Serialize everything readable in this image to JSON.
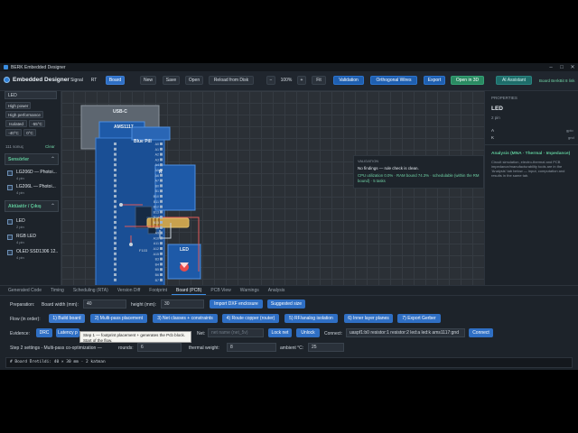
{
  "window": {
    "title": "BERK Embedded Designer"
  },
  "toolbar": {
    "brand": "Embedded Designer",
    "view_tabs": [
      "Signal",
      "RT",
      "Board"
    ],
    "new": "New",
    "save": "Save",
    "open": "Open",
    "reload": "Reload from Disk",
    "zoom_out": "−",
    "zoom": "100%",
    "zoom_in": "+",
    "fit": "Fit",
    "validation": "Validation",
    "orthogonal": "Orthogonal Wires",
    "export": "Export",
    "open3d": "Open in 3D",
    "ai": "AI Assistant",
    "board_info": "Board BerkBit 8 link"
  },
  "sidebar": {
    "search_value": "LED",
    "filters": [
      "High power",
      "High performance",
      "Isolated",
      "-55°C",
      "-40°C",
      "0°C"
    ],
    "results": "111 sonuç",
    "clear": "Clear",
    "categories": [
      {
        "label": "Sensörler",
        "arrow": "⌃",
        "items": [
          {
            "name": "LG206D — Photoi...",
            "sub": "4 pin"
          },
          {
            "name": "LG206L — Photoi...",
            "sub": "4 pin"
          }
        ]
      },
      {
        "label": "Aktüatör / Çıkış",
        "arrow": "⌃",
        "items": [
          {
            "name": "LED",
            "sub": "2 pin"
          },
          {
            "name": "RGB LED",
            "sub": "4 pin"
          },
          {
            "name": "OLED SSD1306 12...",
            "sub": "4 pin"
          }
        ]
      }
    ]
  },
  "canvas": {
    "usb_label": "USB-C",
    "ams_label": "AMS1117",
    "bluepill_label": "Blue Pill",
    "chip_label": "F103",
    "r_label": "R",
    "led_label": "LED",
    "pins": [
      "A0",
      "A1",
      "A2",
      "A3",
      "A4",
      "A5",
      "A6",
      "A7",
      "B0",
      "B1",
      "B10",
      "B11",
      "B12",
      "B13",
      "B14",
      "B15",
      "A8",
      "A9",
      "A10",
      "A11",
      "A12",
      "A15",
      "B3",
      "B4",
      "B5",
      "B6",
      "B7",
      "B8",
      "B9"
    ]
  },
  "validation": {
    "title": "VALIDATION",
    "line1": "No findings — rule check is clean.",
    "line2": "CPU utilization 0.0% · RAM bound 74.3% · schedulable (within the RM bound) · 5 tasks"
  },
  "properties": {
    "title": "PROPERTIES",
    "name": "LED",
    "pins": "2 pin",
    "pin_rows": [
      {
        "pin": "A",
        "net": "gpio"
      },
      {
        "pin": "K",
        "net": "gnd"
      }
    ],
    "analysis_title": "Analysis (MNA · Thermal · Impedance)",
    "analysis_text": "Circuit simulation, electro-thermal and PCB impedance/manufacturability tools are in the 'Analysis' tab below — input, computation and results in the same tab."
  },
  "bottom": {
    "tabs": [
      "Generated Code",
      "Timing",
      "Scheduling (RTA)",
      "Version Diff",
      "Footprint",
      "Board (PCB)",
      "PCB View",
      "Warnings",
      "Analysis"
    ],
    "active_tab": "Board (PCB)",
    "prep_label": "Preparation:",
    "width_label": "Board width (mm):",
    "width_value": "40",
    "height_label": "height (mm):",
    "height_value": "30",
    "import_dxf": "Import DXF enclosure",
    "suggested": "Suggested size",
    "flow_label": "Flow (in order):",
    "flow_steps": [
      "1) Build board",
      "2) Multi-pass placement",
      "3) Net classes + constraints",
      "4) Route copper (router)",
      "5) RF/analog isolation",
      "6) Inner layer planes",
      "7) Export Gerber"
    ],
    "evidence_label": "Evidence:",
    "drc": "DRC",
    "latency": "Latency p",
    "tooltip": "Step 1 — footprint placement + generates the Pcb block. Start of the flow.",
    "net_label": "Net:",
    "net_placeholder": "net name (net_5v)",
    "lock_net": "Lock net",
    "unlock": "Unlock",
    "connect_label": "Connect:",
    "connect_value": "uaspf1:b0 resistor:1 resistor:2 led:a led:k ams1117:gnd",
    "connect_btn": "Connect",
    "step2_label": "Step 2 settings - Multi-pass co-optimization —",
    "rounds_label": "rounds:",
    "rounds_value": "6",
    "thermal_label": "thermal weight:",
    "thermal_value": "8",
    "ambient_label": "ambient °C:",
    "ambient_value": "25",
    "console": "# Board Üretildi: 40 × 30 mm · 2 katman"
  }
}
